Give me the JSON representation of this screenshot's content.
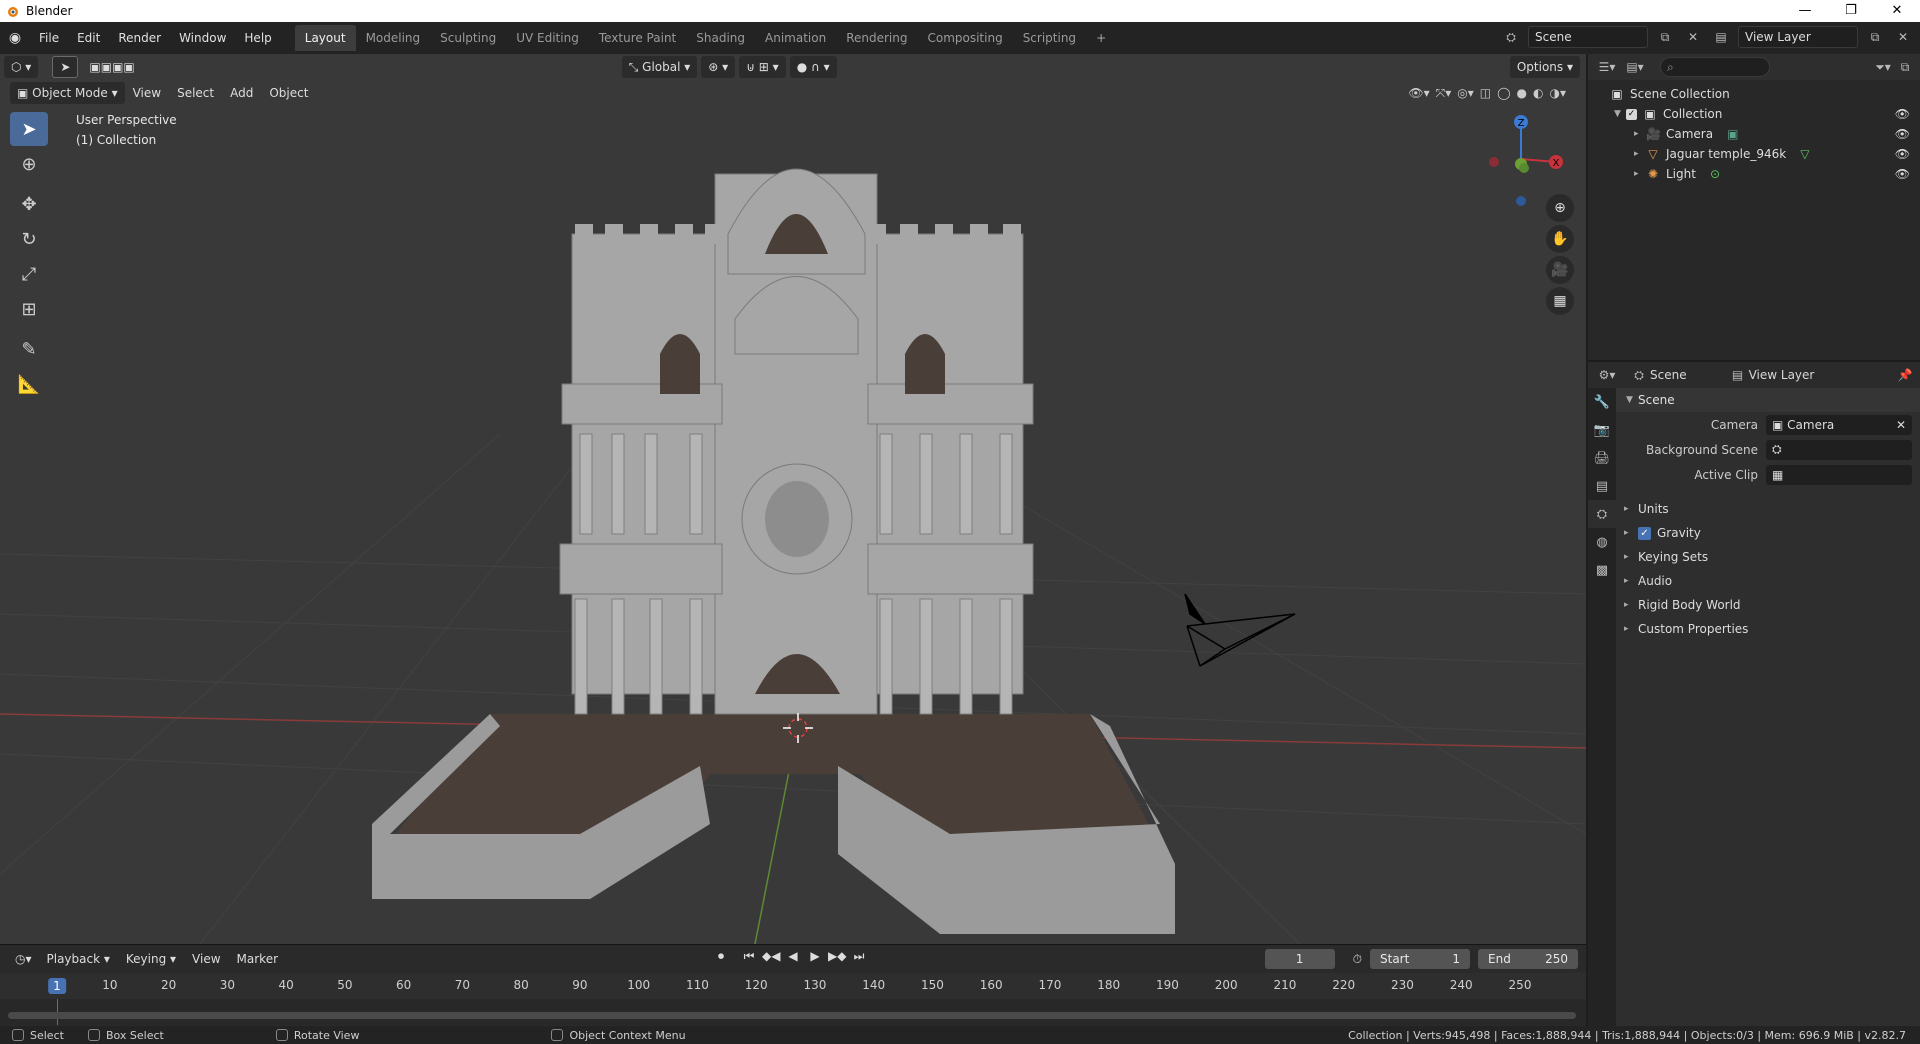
{
  "os": {
    "title": "Blender",
    "min": "—",
    "max": "❐",
    "close": "✕"
  },
  "menu": [
    "File",
    "Edit",
    "Render",
    "Window",
    "Help"
  ],
  "workspaces": [
    "Layout",
    "Modeling",
    "Sculpting",
    "UV Editing",
    "Texture Paint",
    "Shading",
    "Animation",
    "Rendering",
    "Compositing",
    "Scripting"
  ],
  "active_workspace": "Layout",
  "topright": {
    "scene": "Scene",
    "view_layer": "View Layer"
  },
  "viewport": {
    "transform_orientation": "Global",
    "options_label": "Options",
    "mode": "Object Mode",
    "header_menus": [
      "View",
      "Select",
      "Add",
      "Object"
    ],
    "info_line1": "User Perspective",
    "info_line2": "(1) Collection",
    "gizmo": {
      "z": "Z",
      "x": "X"
    }
  },
  "timeline": {
    "menus": [
      "Playback",
      "Keying",
      "View",
      "Marker"
    ],
    "current_frame": "1",
    "start_label": "Start",
    "start": "1",
    "end_label": "End",
    "end": "250",
    "ticks": [
      "1",
      "10",
      "20",
      "30",
      "40",
      "50",
      "60",
      "70",
      "80",
      "90",
      "100",
      "110",
      "120",
      "130",
      "140",
      "150",
      "160",
      "170",
      "180",
      "190",
      "200",
      "210",
      "220",
      "230",
      "240",
      "250"
    ]
  },
  "statusbar": {
    "select": "Select",
    "box_select": "Box Select",
    "rotate_view": "Rotate View",
    "context_menu": "Object Context Menu",
    "stats": "Collection | Verts:945,498 | Faces:1,888,944 | Tris:1,888,944 | Objects:0/3 | Mem: 696.9 MiB | v2.82.7"
  },
  "outliner": {
    "root": "Scene Collection",
    "collection": "Collection",
    "items": [
      "Camera",
      "Jaguar temple_946k",
      "Light"
    ]
  },
  "properties": {
    "header_scene": "Scene",
    "header_view_layer": "View Layer",
    "panel": "Scene",
    "camera_label": "Camera",
    "camera_value": "Camera",
    "background_label": "Background Scene",
    "clip_label": "Active Clip",
    "subpanels": [
      "Units",
      "Gravity",
      "Keying Sets",
      "Audio",
      "Rigid Body World",
      "Custom Properties"
    ]
  },
  "colors": {
    "accent": "#4772b3",
    "x_axis": "#c8323c",
    "y_axis": "#6ca033",
    "z_axis": "#3a7bd5"
  }
}
